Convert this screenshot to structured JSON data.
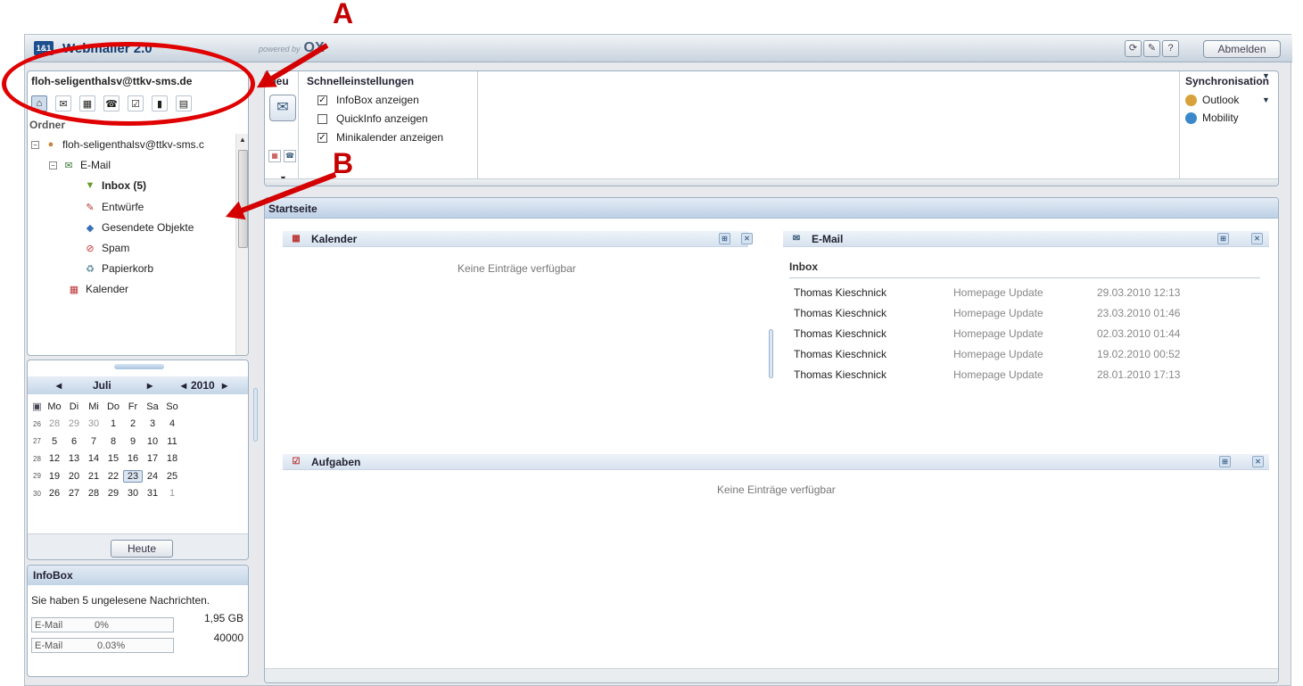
{
  "annotations": {
    "a": "A",
    "b": "B"
  },
  "topbar": {
    "logo_text": "1&1",
    "title": "Webmailer 2.0",
    "ox_sub": "powered by",
    "ox_logo": "OX",
    "icons": [
      "refresh-icon",
      "settings-icon",
      "help-icon"
    ],
    "icon_glyphs": [
      "⟳",
      "✎",
      "?"
    ],
    "logout": "Abmelden"
  },
  "sidebar": {
    "account": "floh-seligenthalsv@ttkv-sms.de",
    "folder_header": "Ordner",
    "modules": [
      {
        "name": "home-icon",
        "glyph": "⌂",
        "active": true
      },
      {
        "name": "email-icon",
        "glyph": "✉",
        "active": false
      },
      {
        "name": "calendar-icon",
        "glyph": "▦",
        "active": false
      },
      {
        "name": "contacts-icon",
        "glyph": "☎",
        "active": false
      },
      {
        "name": "tasks-icon",
        "glyph": "☑",
        "active": false
      },
      {
        "name": "folder-icon",
        "glyph": "▮",
        "active": false
      },
      {
        "name": "infostore-icon",
        "glyph": "▤",
        "active": false
      }
    ],
    "tree": {
      "root": "floh-seligenthalsv@ttkv-sms.c",
      "email": "E-Mail",
      "inbox": "Inbox (5)",
      "drafts": "Entwürfe",
      "sent": "Gesendete Objekte",
      "spam": "Spam",
      "trash": "Papierkorb",
      "calendar": "Kalender"
    }
  },
  "minical": {
    "month": "Juli",
    "year": "2010",
    "prev_month": "◂",
    "next_month": "▸",
    "prev_year": "◂",
    "next_year": "▸",
    "days": [
      "Mo",
      "Di",
      "Mi",
      "Do",
      "Fr",
      "Sa",
      "So"
    ],
    "weeks": [
      {
        "wk": "26",
        "days": [
          "28",
          "29",
          "30",
          "1",
          "2",
          "3",
          "4"
        ]
      },
      {
        "wk": "27",
        "days": [
          "5",
          "6",
          "7",
          "8",
          "9",
          "10",
          "11"
        ]
      },
      {
        "wk": "28",
        "days": [
          "12",
          "13",
          "14",
          "15",
          "16",
          "17",
          "18"
        ]
      },
      {
        "wk": "29",
        "days": [
          "19",
          "20",
          "21",
          "22",
          "23",
          "24",
          "25"
        ]
      },
      {
        "wk": "30",
        "days": [
          "26",
          "27",
          "28",
          "29",
          "30",
          "31",
          "1"
        ]
      }
    ],
    "today": "23",
    "today_button": "Heute"
  },
  "infobox": {
    "title": "InfoBox",
    "message": "Sie haben 5 ungelesene Nachrichten.",
    "quotas": [
      {
        "label": "E-Mail",
        "percent": "0%",
        "fill": 0,
        "value": "1,95 GB"
      },
      {
        "label": "E-Mail",
        "percent": "0.03%",
        "fill": 0.0003,
        "value": "40000"
      }
    ]
  },
  "toolbar": {
    "neu_header": "Neu",
    "schnell_header": "Schnelleinstellungen",
    "checks": [
      {
        "label": "InfoBox anzeigen",
        "checked": true
      },
      {
        "label": "QuickInfo anzeigen",
        "checked": false
      },
      {
        "label": "Minikalender anzeigen",
        "checked": true
      }
    ],
    "sync_header": "Synchronisation",
    "sync_items": [
      {
        "label": "Outlook",
        "color": "#d9a13a"
      },
      {
        "label": "Mobility",
        "color": "#3a88c9"
      }
    ]
  },
  "startpage": {
    "title": "Startseite",
    "calendar_title": "Kalender",
    "calendar_empty": "Keine Einträge verfügbar",
    "email_title": "E-Mail",
    "inbox_label": "Inbox",
    "mails": [
      {
        "from": "Thomas Kieschnick",
        "subject": "Homepage Update",
        "date": "29.03.2010 12:13"
      },
      {
        "from": "Thomas Kieschnick",
        "subject": "Homepage Update",
        "date": "23.03.2010 01:46"
      },
      {
        "from": "Thomas Kieschnick",
        "subject": "Homepage Update",
        "date": "02.03.2010 01:44"
      },
      {
        "from": "Thomas Kieschnick",
        "subject": "Homepage Update",
        "date": "19.02.2010 00:52"
      },
      {
        "from": "Thomas Kieschnick",
        "subject": "Homepage Update",
        "date": "28.01.2010 17:13"
      }
    ],
    "tasks_title": "Aufgaben",
    "tasks_empty": "Keine Einträge verfügbar"
  },
  "colors": {
    "annotation": "#d40000",
    "accent": "#c4d5e7"
  }
}
